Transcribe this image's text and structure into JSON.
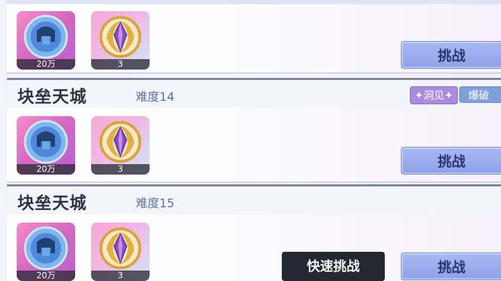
{
  "rows": [
    {
      "items": [
        {
          "icon": "blue-helmet-orb-icon",
          "count": "20万"
        },
        {
          "icon": "purple-crystal-laurel-icon",
          "count": "3"
        }
      ],
      "challenge_label": "挑战"
    },
    {
      "title": "块垒天城",
      "difficulty": "难度14",
      "badges": {
        "insight": "✦洞见✦",
        "burst": "爆破"
      },
      "items": [
        {
          "icon": "blue-helmet-orb-icon",
          "count": "20万"
        },
        {
          "icon": "purple-crystal-laurel-icon",
          "count": "3"
        }
      ],
      "challenge_label": "挑战"
    },
    {
      "title": "块垒天城",
      "difficulty": "难度15",
      "items": [
        {
          "icon": "blue-helmet-orb-icon",
          "count": "20万"
        },
        {
          "icon": "purple-crystal-laurel-icon",
          "count": "3"
        }
      ],
      "challenge_label": "挑战",
      "quick_challenge_label": "快速挑战"
    }
  ],
  "colors": {
    "challenge_button": "#8fa2ea",
    "header_bar": "#7a8496",
    "quick_button": "#24272f"
  }
}
